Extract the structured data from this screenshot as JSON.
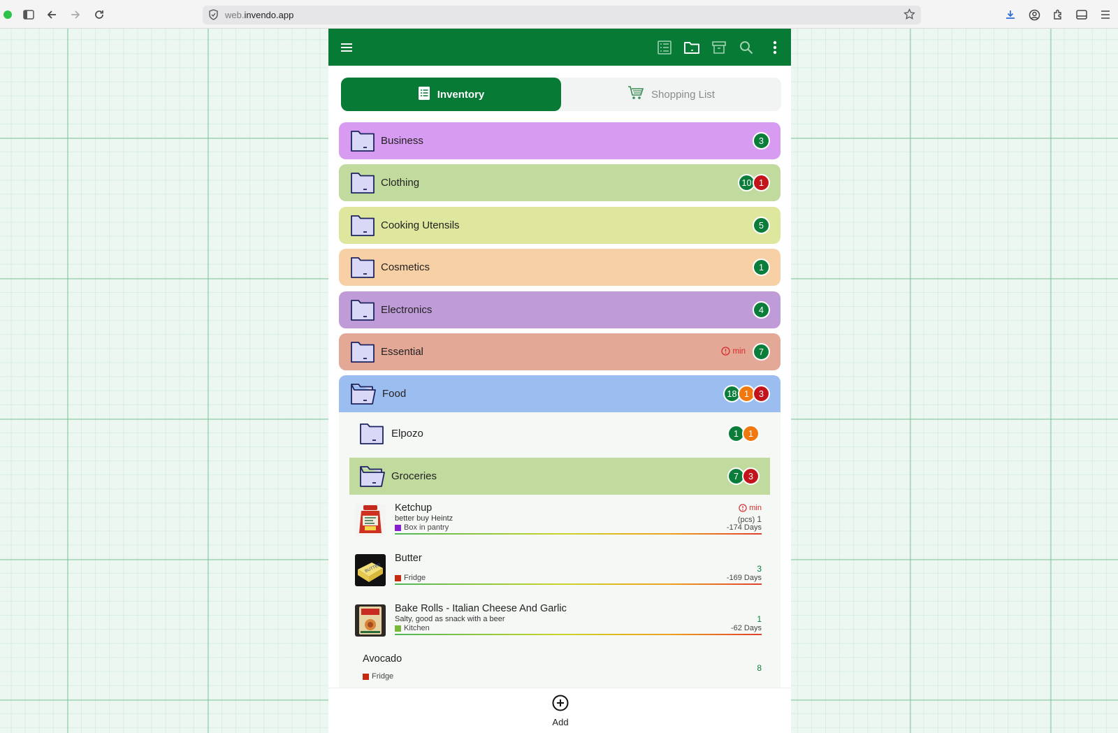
{
  "browser": {
    "url_prefix": "web.",
    "url_domain": "invendo.app"
  },
  "tabs": [
    {
      "label": "Inventory",
      "active": true
    },
    {
      "label": "Shopping List",
      "active": false
    }
  ],
  "folders": [
    {
      "name": "Business",
      "color": "#d79cf1",
      "badges": [
        {
          "value": "3",
          "color": "green"
        }
      ]
    },
    {
      "name": "Clothing",
      "color": "#c1da9e",
      "badges": [
        {
          "value": "10",
          "color": "green"
        },
        {
          "value": "1",
          "color": "red"
        }
      ]
    },
    {
      "name": "Cooking Utensils",
      "color": "#dfe69e",
      "badges": [
        {
          "value": "5",
          "color": "green"
        }
      ]
    },
    {
      "name": "Cosmetics",
      "color": "#f8d0a5",
      "badges": [
        {
          "value": "1",
          "color": "green"
        }
      ]
    },
    {
      "name": "Electronics",
      "color": "#bf9cd8",
      "badges": [
        {
          "value": "4",
          "color": "green"
        }
      ]
    },
    {
      "name": "Essential",
      "color": "#e4a897",
      "warning": "min",
      "badges": [
        {
          "value": "7",
          "color": "green"
        }
      ]
    },
    {
      "name": "Food",
      "color": "#9cbdef",
      "open": true,
      "badges": [
        {
          "value": "18",
          "color": "green"
        },
        {
          "value": "1",
          "color": "orange"
        },
        {
          "value": "3",
          "color": "red"
        }
      ]
    }
  ],
  "subfolders": [
    {
      "name": "Elpozo",
      "color": "#f6f8f6",
      "badges": [
        {
          "value": "1",
          "color": "green"
        },
        {
          "value": "1",
          "color": "orange"
        }
      ]
    },
    {
      "name": "Groceries",
      "color": "#c1da9e",
      "open": true,
      "badges": [
        {
          "value": "7",
          "color": "green"
        },
        {
          "value": "3",
          "color": "red"
        }
      ]
    }
  ],
  "items": [
    {
      "name": "Ketchup",
      "description": "better buy Heintz",
      "location": "Box in pantry",
      "location_color": "#8a1fd0",
      "warning": "min",
      "unit": "(pcs)",
      "quantity": "1",
      "days": "-174 Days",
      "thumb": "ketchup"
    },
    {
      "name": "Butter",
      "description": "",
      "location": "Fridge",
      "location_color": "#c42a12",
      "quantity": "3",
      "days": "-169 Days",
      "thumb": "butter"
    },
    {
      "name": "Bake Rolls - Italian Cheese And Garlic",
      "description": "Salty, good as snack with a beer",
      "location": "Kitchen",
      "location_color": "#7ab83a",
      "quantity": "1",
      "days": "-62 Days",
      "thumb": "rolls"
    },
    {
      "name": "Avocado",
      "description": "",
      "location": "Fridge",
      "location_color": "#c42a12",
      "quantity": "8",
      "days": "",
      "thumb": ""
    }
  ],
  "bottom": {
    "add_label": "Add"
  }
}
